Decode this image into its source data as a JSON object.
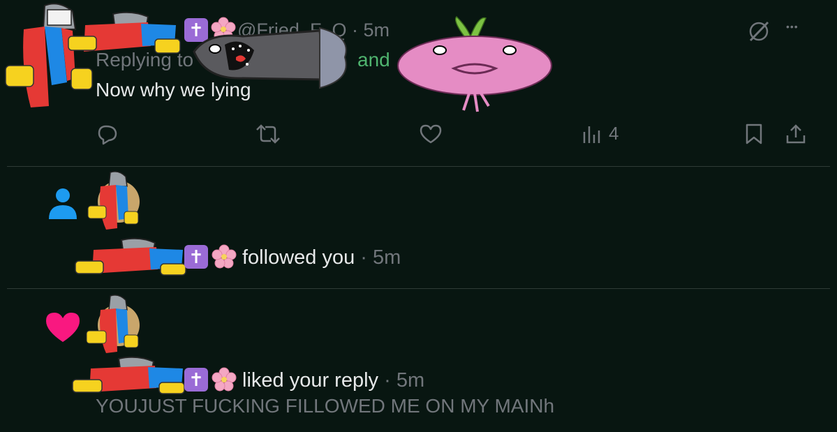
{
  "reply_tweet": {
    "handle": "@Fried_F_Q",
    "separator": "·",
    "time": "5m",
    "replying_to_label": "Replying to",
    "replying_and": "and",
    "text": "Now why we lying",
    "verified_badge_glyph": "✝",
    "flower_badge": "flower-emoji",
    "actions": {
      "reply_icon": "reply-icon",
      "retweet_icon": "retweet-icon",
      "like_icon": "heart-outline-icon",
      "views_icon": "views-chart-icon",
      "views_count": "4",
      "bookmark_icon": "bookmark-icon",
      "share_icon": "share-icon"
    },
    "top_right": {
      "grok_icon": "grok-icon",
      "more_icon": "more-icon",
      "more_glyph": "•••"
    }
  },
  "notifications": [
    {
      "type": "follow",
      "icon": "person-icon",
      "icon_color": "#1d9bf0",
      "badge_glyph": "✝",
      "action_text": "followed you",
      "separator": "·",
      "time": "5m"
    },
    {
      "type": "like",
      "icon": "heart-icon",
      "icon_color": "#f91880",
      "badge_glyph": "✝",
      "action_text": "liked your reply",
      "separator": "·",
      "time": "5m",
      "liked_text": "YOUJUST FUCKING FILLOWED ME ON MY MAINh"
    }
  ],
  "colors": {
    "background": "#081611",
    "text_primary": "#e7e9ea",
    "text_secondary": "#71767b",
    "badge_purple": "#9a6bd6",
    "reply_link_green": "#4fb46f"
  }
}
